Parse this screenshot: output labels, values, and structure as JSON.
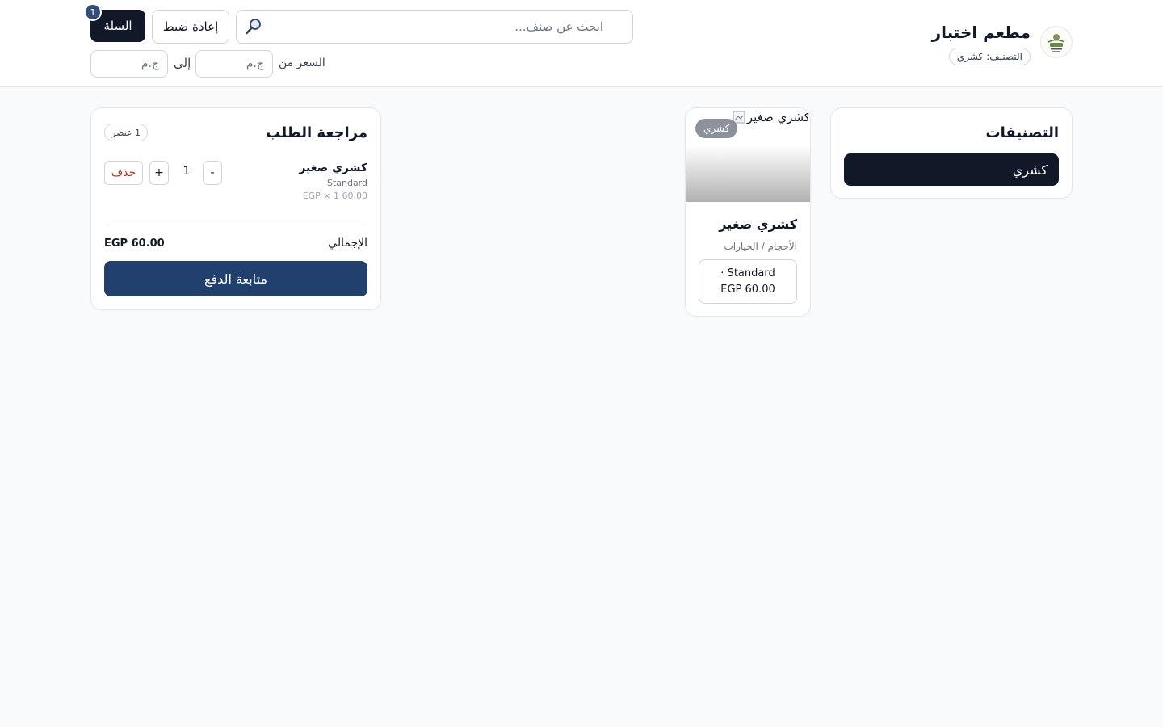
{
  "header": {
    "restaurant_name": "مطعم اختبار",
    "category_label": "التصنيف:",
    "category_value": "كشري",
    "search_placeholder": "ابحث عن صنف...",
    "reset_label": "إعادة ضبط",
    "cart_label": "السلة",
    "cart_count": "1",
    "price_from_label": "السعر من",
    "price_to_label": "إلى",
    "price_placeholder": "ج.م"
  },
  "categories": {
    "title": "التصنيفات",
    "items": [
      {
        "label": "كشري"
      }
    ]
  },
  "products": [
    {
      "image_alt": "كشري صغير",
      "tag": "كشري",
      "name": "كشري صغير",
      "subtitle": "الأحجام / الخيارات",
      "variant_line1": "Standard ·",
      "variant_line2": "60.00 EGP"
    }
  ],
  "order": {
    "title": "مراجعة الطلب",
    "items_badge": "1 عنصر",
    "lines": [
      {
        "name": "كشري صغير",
        "variant": "Standard",
        "price_detail": "EGP × 1 60.00",
        "quantity": "1",
        "minus_label": "-",
        "plus_label": "+",
        "remove_label": "حذف"
      }
    ],
    "total_label": "الإجمالي",
    "total_value": "EGP 60.00",
    "checkout_label": "متابعة الدفع"
  },
  "colors": {
    "primary_dark": "#111827",
    "checkout_blue": "#22406e",
    "badge_blue": "#334d7a",
    "danger": "#c0392b",
    "background": "#f8fafc"
  },
  "icons": {
    "search": "search-icon",
    "logo": "restaurant-logo-icon",
    "broken_image": "broken-image-icon"
  }
}
